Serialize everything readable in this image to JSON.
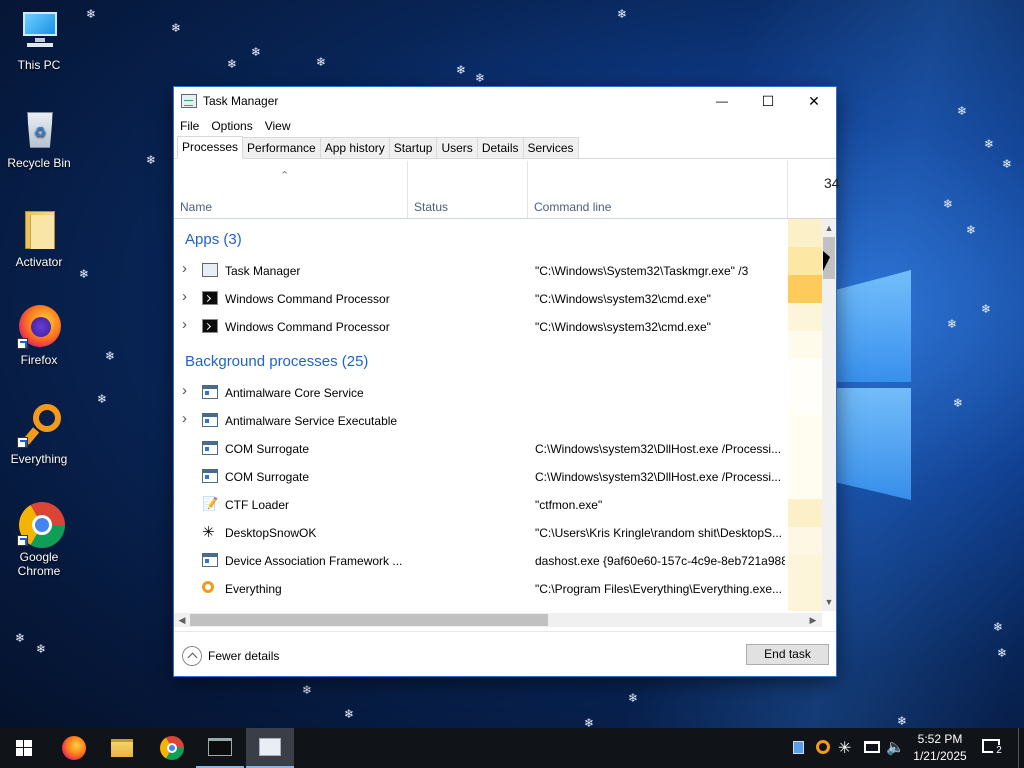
{
  "desktop": {
    "icons": [
      {
        "label": "This PC"
      },
      {
        "label": "Recycle Bin"
      },
      {
        "label": "Activator"
      },
      {
        "label": "Firefox"
      },
      {
        "label": "Everything"
      },
      {
        "label": "Google Chrome"
      }
    ]
  },
  "window": {
    "title": "Task Manager",
    "controls": {
      "minimize": "—",
      "maximize": "☐",
      "close": "✕"
    },
    "menu": [
      "File",
      "Options",
      "View"
    ],
    "tabs": [
      "Processes",
      "Performance",
      "App history",
      "Startup",
      "Users",
      "Details",
      "Services"
    ],
    "active_tab": "Processes",
    "columns": {
      "name": "Name",
      "status": "Status",
      "command_line": "Command line",
      "cpu_percent": "34"
    },
    "groups": {
      "apps": "Apps (3)",
      "background": "Background processes (25)"
    },
    "rows": [
      {
        "name": "Task Manager",
        "cmd": "\"C:\\Windows\\System32\\Taskmgr.exe\" /3",
        "icon": "task-manager-icon",
        "expandable": true
      },
      {
        "name": "Windows Command Processor",
        "cmd": "\"C:\\Windows\\system32\\cmd.exe\"",
        "icon": "cmd-icon",
        "expandable": true
      },
      {
        "name": "Windows Command Processor",
        "cmd": "\"C:\\Windows\\system32\\cmd.exe\"",
        "icon": "cmd-icon",
        "expandable": true
      },
      {
        "name": "Antimalware Core Service",
        "cmd": "",
        "icon": "service-icon",
        "expandable": true
      },
      {
        "name": "Antimalware Service Executable",
        "cmd": "",
        "icon": "service-icon",
        "expandable": true
      },
      {
        "name": "COM Surrogate",
        "cmd": "C:\\Windows\\system32\\DllHost.exe /Processi...",
        "icon": "service-icon",
        "expandable": false
      },
      {
        "name": "COM Surrogate",
        "cmd": "C:\\Windows\\system32\\DllHost.exe /Processi...",
        "icon": "service-icon",
        "expandable": false
      },
      {
        "name": "CTF Loader",
        "cmd": "\"ctfmon.exe\"",
        "icon": "ctf-loader-icon",
        "expandable": false
      },
      {
        "name": "DesktopSnowOK",
        "cmd": "\"C:\\Users\\Kris Kringle\\random shit\\DesktopS...",
        "icon": "snowflake-icon",
        "expandable": false
      },
      {
        "name": "Device Association Framework ...",
        "cmd": "dashost.exe {9af60e60-157c-4c9e-8eb721a988...",
        "icon": "service-icon",
        "expandable": false
      },
      {
        "name": "Everything",
        "cmd": "\"C:\\Program Files\\Everything\\Everything.exe...",
        "icon": "everything-icon",
        "expandable": false
      }
    ],
    "cpu_heat": [
      "#fbf0c7",
      "#fde7a5",
      "#fdcb5c",
      "#fdf5da",
      "#fffbeb",
      "#fffef8",
      "#fffef8",
      "#fffcf0",
      "#fffcf0",
      "#fffcf0",
      "#fbf0c7",
      "#fdf7e4",
      "#fdf5da",
      "#fdf5da"
    ],
    "footer": {
      "fewer_details": "Fewer details",
      "end_task": "End task"
    }
  },
  "taskbar": {
    "time": "5:52 PM",
    "date": "1/21/2025",
    "notification_count": "2"
  }
}
